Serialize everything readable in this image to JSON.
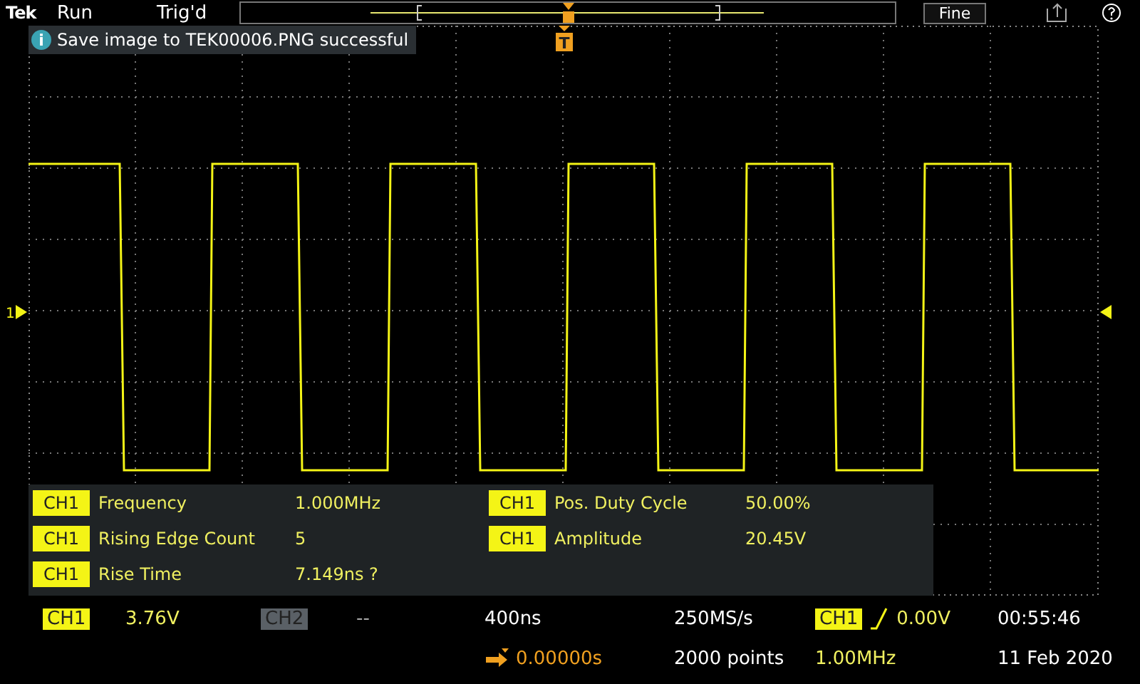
{
  "top_bar": {
    "logo": "Tek",
    "run_state": "Run",
    "trigger_state": "Trig'd",
    "fine_button": "Fine"
  },
  "notification": {
    "icon_text": "i",
    "message": "Save image to TEK00006.PNG successful"
  },
  "markers": {
    "channel_marker": "1",
    "trigger_marker": "T"
  },
  "measurements": [
    {
      "channel": "CH1",
      "name": "Frequency",
      "value": "1.000MHz"
    },
    {
      "channel": "CH1",
      "name": "Pos. Duty Cycle",
      "value": "50.00%"
    },
    {
      "channel": "CH1",
      "name": "Rising Edge Count",
      "value": "5"
    },
    {
      "channel": "CH1",
      "name": "Amplitude",
      "value": "20.45V"
    },
    {
      "channel": "CH1",
      "name": "Rise Time",
      "value": "7.149ns  ?"
    }
  ],
  "channels": [
    {
      "label": "CH1",
      "on": true,
      "scale": "3.76V"
    },
    {
      "label": "CH2",
      "on": false,
      "scale": "--"
    }
  ],
  "horizontal": {
    "scale": "400ns",
    "position": "0.00000s"
  },
  "acquisition": {
    "sample_rate": "250MS/s",
    "record_length": "2000 points"
  },
  "trigger": {
    "source": "CH1",
    "level": "0.00V",
    "frequency": "1.00MHz"
  },
  "clock": {
    "time": "00:55:46",
    "date": "11 Feb 2020"
  }
}
